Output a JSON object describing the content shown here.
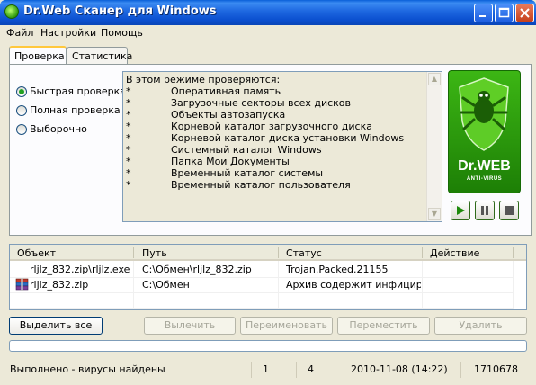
{
  "window": {
    "title": "Dr.Web Сканер для Windows",
    "controls": {
      "minimize": "_",
      "maximize": "□",
      "close": "✕"
    }
  },
  "menu": [
    "Файл",
    "Настройки",
    "Помощь"
  ],
  "tabs": [
    {
      "label": "Проверка",
      "active": true
    },
    {
      "label": "Статистика",
      "active": false
    }
  ],
  "scan_modes": [
    {
      "label": "Быстрая проверка",
      "selected": true
    },
    {
      "label": "Полная проверка",
      "selected": false
    },
    {
      "label": "Выборочно",
      "selected": false
    }
  ],
  "info": {
    "heading": "В этом режиме проверяются:",
    "bullet": "*",
    "items": [
      "Оперативная память",
      "Загрузочные секторы всех дисков",
      "Объекты автозапуска",
      "Корневой каталог загрузочного диска",
      "Корневой каталог диска установки Windows",
      "Системный каталог Windows",
      "Папка Мои Документы",
      "Временный каталог системы",
      "Временный каталог пользователя"
    ]
  },
  "logo": {
    "brand": "Dr.WEB",
    "sub": "ANTI-VIRUS",
    "accent": "#3cb614"
  },
  "scan_controls": [
    {
      "name": "start",
      "icon": "play-icon"
    },
    {
      "name": "pause",
      "icon": "pause-icon"
    },
    {
      "name": "stop",
      "icon": "stop-icon"
    }
  ],
  "results": {
    "columns": [
      "Объект",
      "Путь",
      "Статус",
      "Действие"
    ],
    "rows": [
      {
        "object": "rljlz_832.zip\\rljlz.exe",
        "path": "C:\\Обмен\\rljlz_832.zip",
        "status": "Trojan.Packed.21155",
        "action": "",
        "icon": ""
      },
      {
        "object": "rljlz_832.zip",
        "path": "C:\\Обмен",
        "status": "Архив содержит инфициp...",
        "action": "",
        "icon": "archive-icon"
      }
    ]
  },
  "actions": {
    "select_all": "Выделить все",
    "cure": "Вылечить",
    "rename": "Переименовать",
    "move": "Переместить",
    "delete": "Удалить"
  },
  "progress": {
    "fraction": 0
  },
  "status": {
    "message": "Выполнено - вирусы найдены",
    "count1": "1",
    "count2": "4",
    "datetime": "2010-11-08 (14:22)",
    "number": "1710678"
  }
}
